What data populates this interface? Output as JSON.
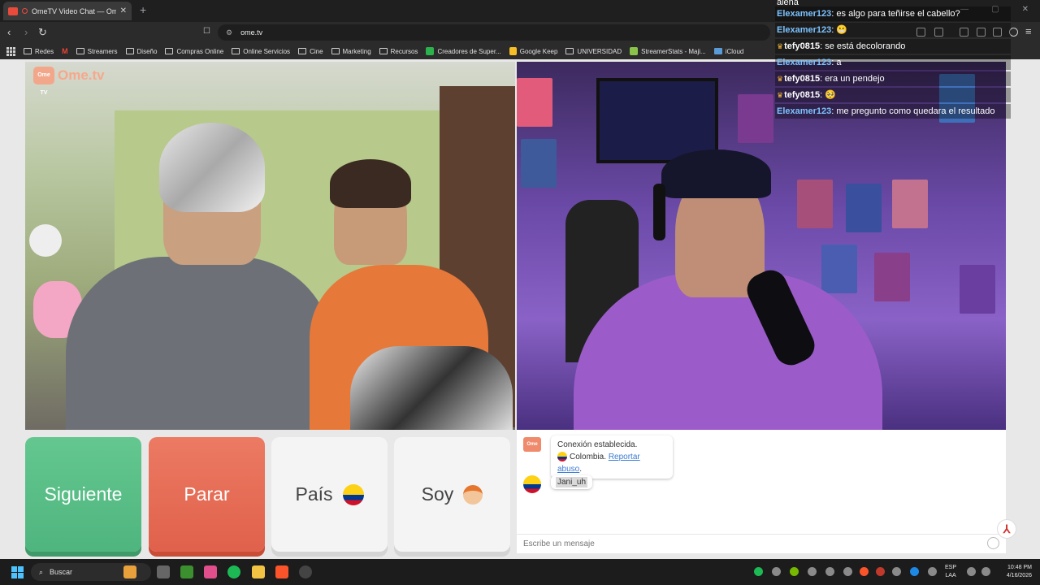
{
  "browser": {
    "tab_title": "OmeTV Video Chat — Omeg",
    "url": "ome.tv",
    "bookmarks": [
      {
        "label": "Redes",
        "icon": "folder-icon"
      },
      {
        "label": "",
        "icon": "gmail-icon"
      },
      {
        "label": "Streamers",
        "icon": "folder-icon"
      },
      {
        "label": "Diseño",
        "icon": "folder-icon"
      },
      {
        "label": "Compras Online",
        "icon": "folder-icon"
      },
      {
        "label": "Online Servicios",
        "icon": "folder-icon"
      },
      {
        "label": "Cine",
        "icon": "folder-icon"
      },
      {
        "label": "Marketing",
        "icon": "folder-icon"
      },
      {
        "label": "Recursos",
        "icon": "folder-icon"
      },
      {
        "label": "Creadores de Super...",
        "icon": "link-icon"
      },
      {
        "label": "Google Keep",
        "icon": "keep-icon"
      },
      {
        "label": "UNIVERSIDAD",
        "icon": "folder-icon"
      },
      {
        "label": "StreamerStats - Maji...",
        "icon": "link-icon"
      },
      {
        "label": "iCloud",
        "icon": "folder-icon"
      }
    ]
  },
  "site": {
    "logo_text": "Ome.tv",
    "logo_badge": "Ome TV"
  },
  "stream_chat": {
    "top_fragment": "ajena",
    "messages": [
      {
        "user": "Elexamer123",
        "text": ": es algo para teñirse el cabello?",
        "vip": false
      },
      {
        "user": "Elexamer123",
        "text": ": 😬",
        "vip": false
      },
      {
        "user": "tefy0815",
        "text": ": se está decolorando",
        "vip": true
      },
      {
        "user": "Elexamer123",
        "text": ": a",
        "vip": false
      },
      {
        "user": "tefy0815",
        "text": ": era un pendejo",
        "vip": true
      },
      {
        "user": "tefy0815",
        "text": ": 🥺",
        "vip": true
      },
      {
        "user": "Elexamer123",
        "text": ": me pregunto como quedara el resultado",
        "vip": false
      }
    ]
  },
  "controls": {
    "next_label": "Siguiente",
    "stop_label": "Parar",
    "country_label": "País",
    "gender_label": "Soy"
  },
  "chat": {
    "connection_text": "Conexión establecida.",
    "country_name": "Colombia.",
    "report_link": "Reportar abuso",
    "report_suffix": ".",
    "partner_username": "Jani_uh",
    "input_placeholder": "Escribe un mensaje"
  },
  "taskbar": {
    "search_label": "Buscar",
    "lang_line1": "ESP",
    "lang_line2": "LAA",
    "time": "10:48 PM",
    "date": "4/16/2026"
  },
  "colors": {
    "next_button": "#59bd85",
    "stop_button": "#e56c54",
    "chat_username": "#7cc3ff",
    "link": "#3a7bd5"
  }
}
